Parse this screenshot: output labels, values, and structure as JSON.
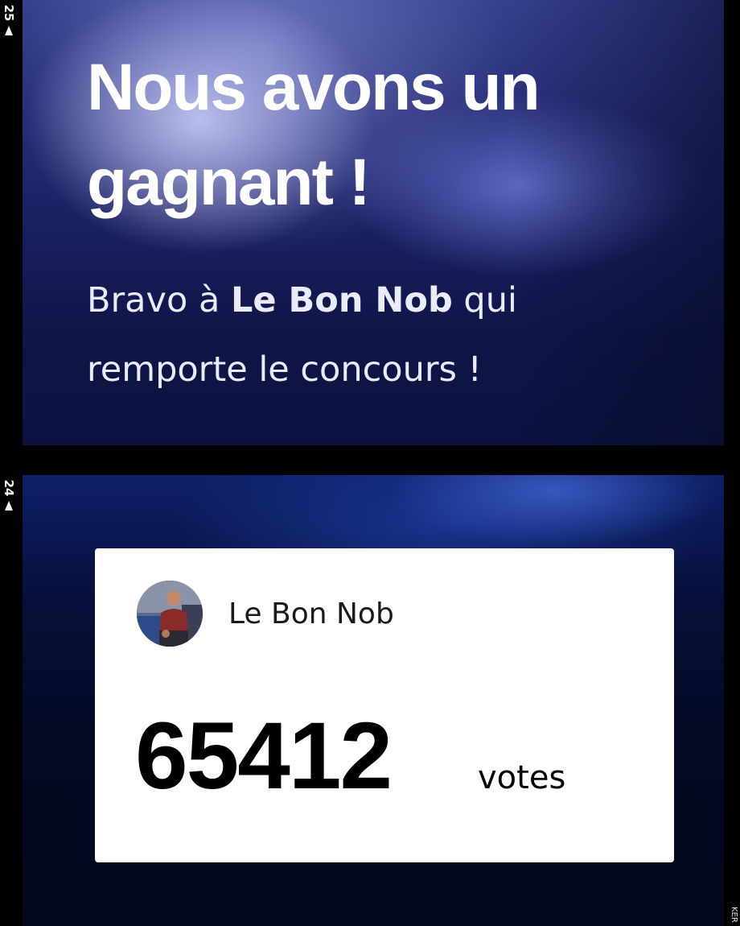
{
  "frames": {
    "top_number": "25",
    "bottom_number": "24",
    "edge_mark": "KER"
  },
  "announcement": {
    "headline": "Nous avons un gagnant !",
    "subtitle_prefix": "Bravo à",
    "subtitle_winner": "Le Bon Nob",
    "subtitle_suffix": "qui remporte le concours !"
  },
  "result_card": {
    "author": "Le Bon Nob",
    "vote_count": "65412",
    "vote_unit": "votes"
  },
  "colors": {
    "panel_top_base": "#1c2366",
    "panel_bottom_base": "#040a26",
    "card_background": "#ffffff",
    "headline_text": "#ffffff"
  }
}
